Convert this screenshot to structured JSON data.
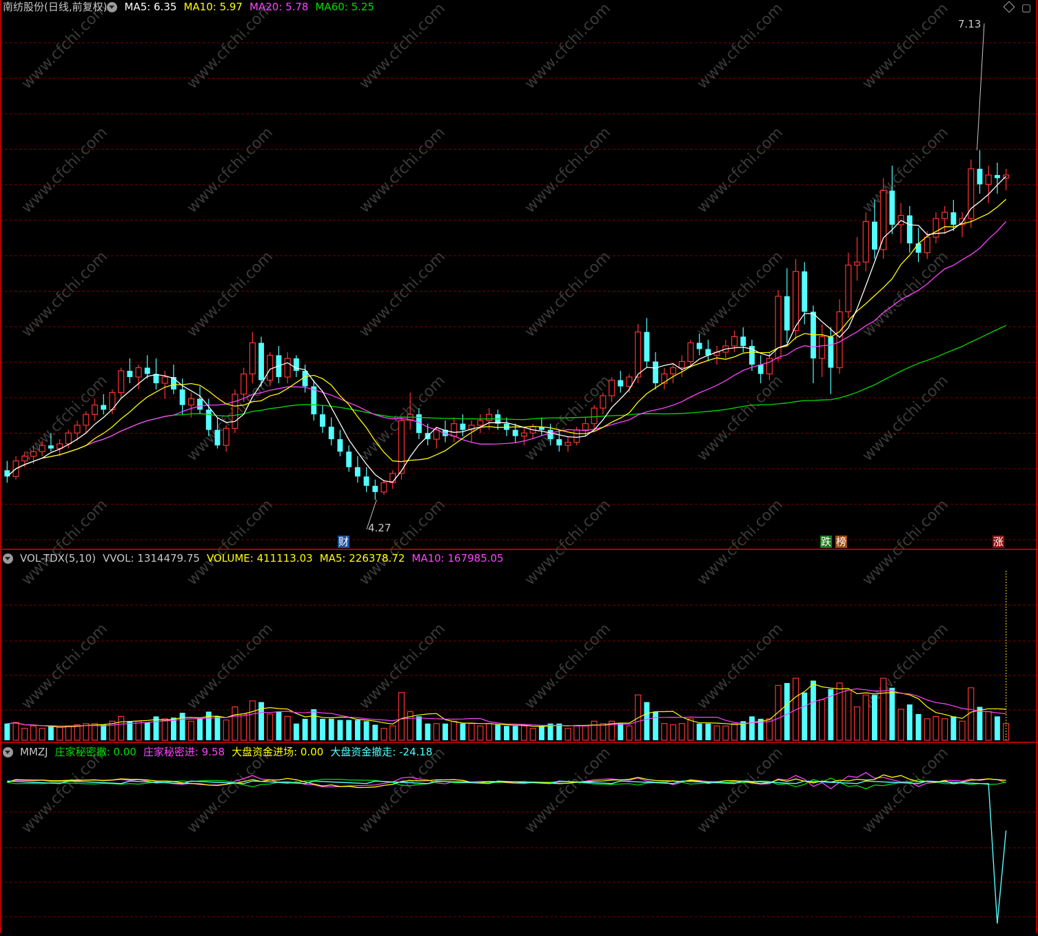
{
  "main_panel": {
    "stock_title": "南纺股份(日线,前复权)",
    "ma5": "MA5: 6.35",
    "ma10": "MA10: 5.97",
    "ma20": "MA20: 5.78",
    "ma60": "MA60: 5.25",
    "high_label": "7.13",
    "low_label": "4.27",
    "badges": {
      "cai": "财",
      "die": "跌",
      "bang": "榜",
      "zhang": "涨"
    }
  },
  "volume_panel": {
    "indicator": "VOL-TDX(5,10)",
    "vvol": "VVOL: 1314479.75",
    "volume": "VOLUME: 411113.03",
    "ma5": "MA5: 226378.72",
    "ma10": "MA10: 167985.05"
  },
  "mmzj_panel": {
    "indicator": "MMZJ",
    "zj_che": "庄家秘密撤: 0.00",
    "zj_jin": "庄家秘密进: 9.58",
    "dp_jin": "大盘资金进场: 0.00",
    "dp_che": "大盘资金撤走: -24.18"
  },
  "watermark": "www.cfchi.com",
  "colors": {
    "up": "#ff3333",
    "down": "#54ffff",
    "ma5": "#ffffff",
    "ma10": "#ffff00",
    "ma20": "#ff44ff",
    "ma60": "#00dd00",
    "grid": "#7a0000",
    "border": "#b00000"
  },
  "chart_data": [
    {
      "type": "candlestick",
      "title": "南纺股份(日线,前复权)",
      "ylim": [
        4.0,
        7.3
      ],
      "series_legend": [
        "MA5",
        "MA10",
        "MA20",
        "MA60"
      ],
      "annotated_extremes": {
        "high": 7.13,
        "low": 4.27
      },
      "ohlc": [
        [
          4.46,
          4.52,
          4.38,
          4.42
        ],
        [
          4.42,
          4.55,
          4.4,
          4.52
        ],
        [
          4.52,
          4.58,
          4.48,
          4.55
        ],
        [
          4.55,
          4.62,
          4.5,
          4.58
        ],
        [
          4.58,
          4.65,
          4.55,
          4.62
        ],
        [
          4.62,
          4.7,
          4.58,
          4.6
        ],
        [
          4.6,
          4.66,
          4.55,
          4.63
        ],
        [
          4.63,
          4.72,
          4.6,
          4.7
        ],
        [
          4.7,
          4.78,
          4.65,
          4.75
        ],
        [
          4.75,
          4.84,
          4.7,
          4.82
        ],
        [
          4.82,
          4.92,
          4.78,
          4.88
        ],
        [
          4.88,
          4.95,
          4.82,
          4.85
        ],
        [
          4.85,
          4.98,
          4.82,
          4.96
        ],
        [
          4.96,
          5.12,
          4.92,
          5.1
        ],
        [
          5.1,
          5.18,
          5.02,
          5.06
        ],
        [
          5.06,
          5.14,
          4.98,
          5.12
        ],
        [
          5.12,
          5.2,
          5.05,
          5.08
        ],
        [
          5.08,
          5.18,
          4.98,
          5.02
        ],
        [
          5.02,
          5.1,
          4.92,
          5.06
        ],
        [
          5.06,
          5.14,
          4.95,
          4.98
        ],
        [
          4.98,
          5.05,
          4.82,
          4.88
        ],
        [
          4.88,
          4.96,
          4.8,
          4.92
        ],
        [
          4.92,
          5.0,
          4.82,
          4.85
        ],
        [
          4.85,
          4.92,
          4.68,
          4.72
        ],
        [
          4.72,
          4.8,
          4.6,
          4.62
        ],
        [
          4.62,
          4.75,
          4.58,
          4.73
        ],
        [
          4.73,
          4.98,
          4.7,
          4.95
        ],
        [
          4.95,
          5.12,
          4.9,
          5.08
        ],
        [
          5.08,
          5.35,
          5.02,
          5.28
        ],
        [
          5.28,
          5.32,
          5.0,
          5.04
        ],
        [
          5.04,
          5.22,
          5.0,
          5.2
        ],
        [
          5.2,
          5.26,
          5.02,
          5.06
        ],
        [
          5.06,
          5.22,
          5.02,
          5.18
        ],
        [
          5.18,
          5.2,
          5.06,
          5.1
        ],
        [
          5.1,
          5.14,
          4.96,
          5.0
        ],
        [
          5.0,
          5.04,
          4.78,
          4.82
        ],
        [
          4.82,
          4.88,
          4.7,
          4.74
        ],
        [
          4.74,
          4.8,
          4.62,
          4.66
        ],
        [
          4.66,
          4.72,
          4.55,
          4.58
        ],
        [
          4.58,
          4.62,
          4.45,
          4.48
        ],
        [
          4.48,
          4.55,
          4.38,
          4.42
        ],
        [
          4.42,
          4.48,
          4.32,
          4.36
        ],
        [
          4.36,
          4.4,
          4.27,
          4.32
        ],
        [
          4.32,
          4.4,
          4.3,
          4.38
        ],
        [
          4.38,
          4.46,
          4.34,
          4.44
        ],
        [
          4.44,
          4.8,
          4.4,
          4.78
        ],
        [
          4.78,
          4.96,
          4.72,
          4.82
        ],
        [
          4.82,
          4.86,
          4.66,
          4.7
        ],
        [
          4.7,
          4.76,
          4.62,
          4.66
        ],
        [
          4.66,
          4.74,
          4.6,
          4.72
        ],
        [
          4.72,
          4.78,
          4.64,
          4.68
        ],
        [
          4.68,
          4.8,
          4.64,
          4.76
        ],
        [
          4.76,
          4.82,
          4.68,
          4.72
        ],
        [
          4.72,
          4.78,
          4.64,
          4.75
        ],
        [
          4.75,
          4.82,
          4.7,
          4.78
        ],
        [
          4.78,
          4.86,
          4.72,
          4.82
        ],
        [
          4.82,
          4.85,
          4.72,
          4.76
        ],
        [
          4.76,
          4.8,
          4.68,
          4.72
        ],
        [
          4.72,
          4.76,
          4.64,
          4.68
        ],
        [
          4.68,
          4.74,
          4.62,
          4.7
        ],
        [
          4.7,
          4.76,
          4.66,
          4.74
        ],
        [
          4.74,
          4.8,
          4.68,
          4.72
        ],
        [
          4.72,
          4.76,
          4.62,
          4.66
        ],
        [
          4.66,
          4.72,
          4.58,
          4.62
        ],
        [
          4.62,
          4.68,
          4.58,
          4.64
        ],
        [
          4.64,
          4.74,
          4.62,
          4.72
        ],
        [
          4.72,
          4.8,
          4.68,
          4.76
        ],
        [
          4.76,
          4.88,
          4.72,
          4.86
        ],
        [
          4.86,
          4.96,
          4.82,
          4.94
        ],
        [
          4.94,
          5.06,
          4.9,
          5.04
        ],
        [
          5.04,
          5.1,
          4.96,
          5.0
        ],
        [
          5.0,
          5.08,
          4.96,
          5.06
        ],
        [
          5.06,
          5.4,
          5.02,
          5.35
        ],
        [
          5.35,
          5.44,
          5.12,
          5.16
        ],
        [
          5.16,
          5.22,
          4.98,
          5.02
        ],
        [
          5.02,
          5.12,
          4.98,
          5.08
        ],
        [
          5.08,
          5.15,
          5.02,
          5.12
        ],
        [
          5.12,
          5.2,
          5.06,
          5.16
        ],
        [
          5.16,
          5.3,
          5.12,
          5.28
        ],
        [
          5.28,
          5.34,
          5.2,
          5.24
        ],
        [
          5.24,
          5.3,
          5.16,
          5.2
        ],
        [
          5.2,
          5.26,
          5.14,
          5.22
        ],
        [
          5.22,
          5.3,
          5.18,
          5.26
        ],
        [
          5.26,
          5.36,
          5.22,
          5.32
        ],
        [
          5.32,
          5.38,
          5.22,
          5.26
        ],
        [
          5.26,
          5.3,
          5.1,
          5.14
        ],
        [
          5.14,
          5.2,
          5.02,
          5.08
        ],
        [
          5.08,
          5.22,
          5.04,
          5.18
        ],
        [
          5.18,
          5.62,
          5.16,
          5.58
        ],
        [
          5.58,
          5.76,
          5.28,
          5.36
        ],
        [
          5.36,
          5.82,
          5.3,
          5.74
        ],
        [
          5.74,
          5.8,
          5.4,
          5.48
        ],
        [
          5.48,
          5.52,
          5.02,
          5.18
        ],
        [
          5.18,
          5.4,
          5.06,
          5.32
        ],
        [
          5.32,
          5.38,
          4.95,
          5.12
        ],
        [
          5.12,
          5.56,
          5.08,
          5.48
        ],
        [
          5.48,
          5.86,
          5.44,
          5.78
        ],
        [
          5.78,
          5.96,
          5.68,
          5.8
        ],
        [
          5.8,
          6.12,
          5.74,
          6.06
        ],
        [
          6.06,
          6.2,
          5.82,
          5.88
        ],
        [
          5.88,
          6.34,
          5.82,
          6.26
        ],
        [
          6.26,
          6.42,
          5.98,
          6.04
        ],
        [
          6.04,
          6.18,
          5.92,
          6.1
        ],
        [
          6.1,
          6.16,
          5.86,
          5.92
        ],
        [
          5.92,
          6.02,
          5.8,
          5.86
        ],
        [
          5.86,
          6.0,
          5.82,
          5.96
        ],
        [
          5.96,
          6.12,
          5.92,
          6.08
        ],
        [
          6.08,
          6.16,
          5.98,
          6.12
        ],
        [
          6.12,
          6.2,
          6.0,
          6.04
        ],
        [
          6.04,
          6.12,
          5.96,
          6.08
        ],
        [
          6.08,
          6.46,
          6.02,
          6.4
        ],
        [
          6.4,
          6.52,
          6.24,
          6.3
        ],
        [
          6.3,
          6.42,
          6.18,
          6.36
        ],
        [
          6.36,
          6.44,
          6.24,
          6.34
        ],
        [
          6.34,
          6.4,
          6.26,
          6.36
        ]
      ]
    },
    {
      "type": "bar",
      "title": "VOL-TDX(5,10)",
      "series_legend": [
        "VOLUME",
        "MA5",
        "MA10"
      ],
      "latest": {
        "VVOL": 1314479.75,
        "VOLUME": 411113.03,
        "MA5": 226378.72,
        "MA10": 167985.05
      }
    },
    {
      "type": "line",
      "title": "MMZJ",
      "series": [
        {
          "name": "庄家秘密撤",
          "latest": 0.0
        },
        {
          "name": "庄家秘密进",
          "latest": 9.58
        },
        {
          "name": "大盘资金进场",
          "latest": 0.0
        },
        {
          "name": "大盘资金撤走",
          "latest": -24.18
        }
      ]
    }
  ]
}
